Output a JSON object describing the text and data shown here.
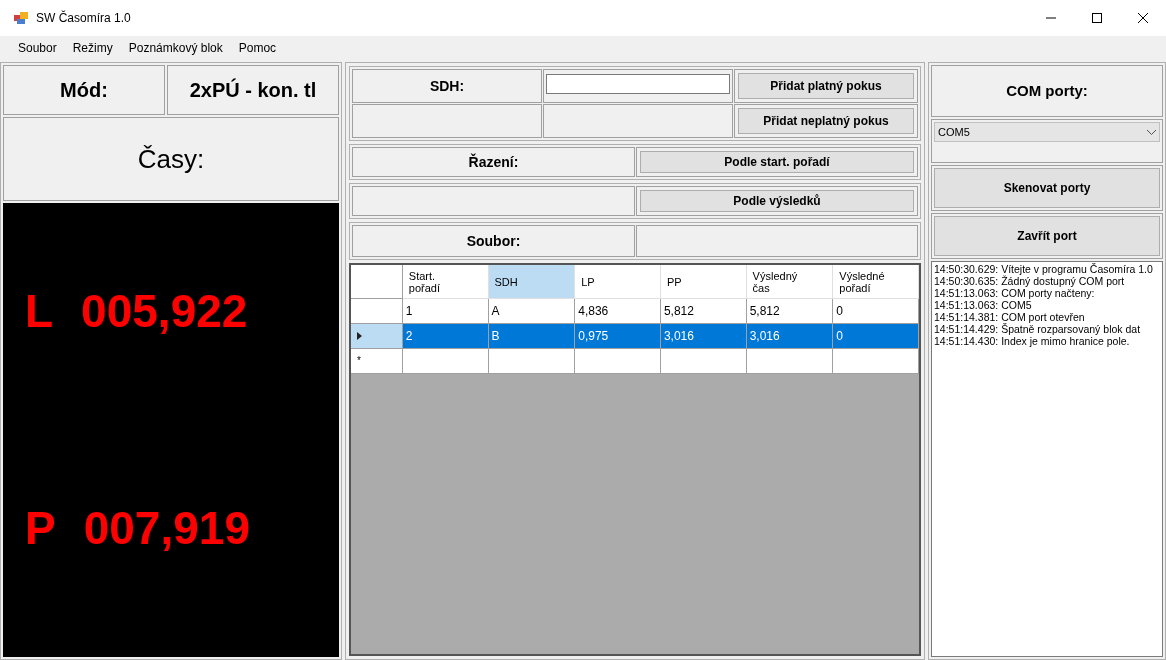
{
  "window": {
    "title": "SW Časomíra 1.0"
  },
  "menu": [
    "Soubor",
    "Režimy",
    "Poznámkový blok",
    "Pomoc"
  ],
  "mode": {
    "label": "Mód:",
    "value": "2xPÚ - kon. tl"
  },
  "times": {
    "label": "Časy:",
    "timers": [
      {
        "side": "L",
        "value": "005,922"
      },
      {
        "side": "P",
        "value": "007,919"
      }
    ]
  },
  "form": {
    "sdh_label": "SDH:",
    "add_valid": "Přidat platný pokus",
    "add_invalid": "Přidat neplatný pokus",
    "sort_label": "Řazení:",
    "sort_start": "Podle start. pořadí",
    "sort_results": "Podle výsledků",
    "file_label": "Soubor:"
  },
  "table": {
    "columns": [
      {
        "label": "Start.\npořadí",
        "selected": false
      },
      {
        "label": "SDH",
        "selected": true
      },
      {
        "label": "LP",
        "selected": false
      },
      {
        "label": "PP",
        "selected": false
      },
      {
        "label": "Výsledný\nčas",
        "selected": false
      },
      {
        "label": "Výsledné\npořadí",
        "selected": false
      }
    ],
    "rows": [
      {
        "kind": "data",
        "selected": false,
        "cells": [
          "1",
          "A",
          "4,836",
          "5,812",
          "5,812",
          "0"
        ]
      },
      {
        "kind": "data",
        "selected": true,
        "cells": [
          "2",
          "B",
          "0,975",
          "3,016",
          "3,016",
          "0"
        ]
      },
      {
        "kind": "new",
        "selected": false,
        "marker": "*",
        "cells": []
      }
    ]
  },
  "com": {
    "label": "COM porty:",
    "port": "COM5",
    "scan": "Skenovat porty",
    "close": "Zavřít port"
  },
  "log": [
    "14:50:30.629: Vítejte v programu Časomíra 1.0",
    "14:50:30.635: Žádný dostupný COM port",
    "14:51:13.063: COM porty načteny:",
    "14:51:13.063: COM5",
    "14:51:14.381: COM port otevřen",
    "14:51:14.429: Špatně rozparsovaný blok dat",
    "14:51:14.430: Index je mimo hranice pole."
  ]
}
